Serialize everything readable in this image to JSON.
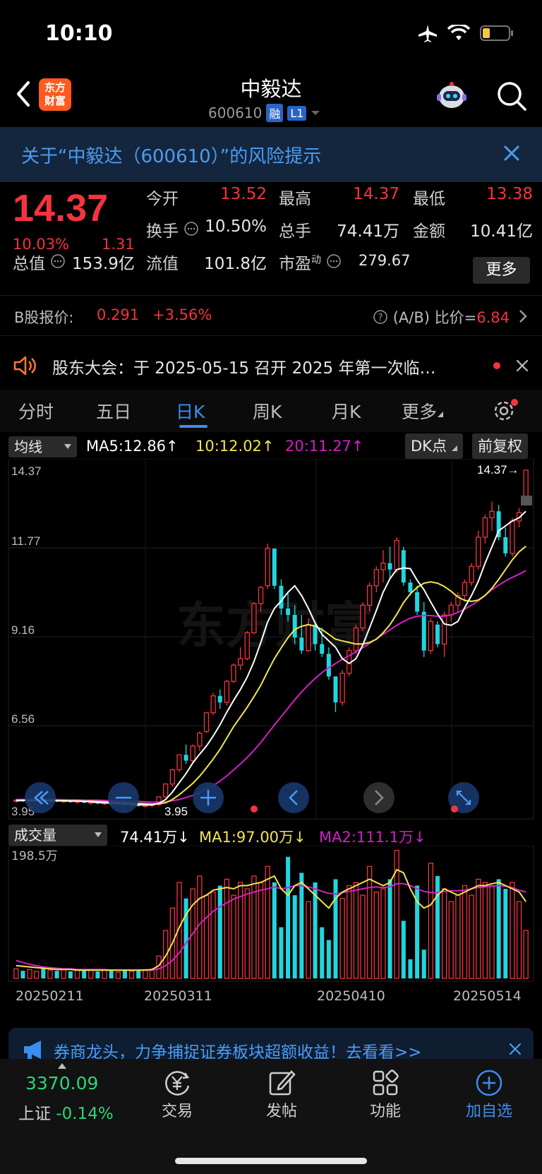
{
  "status": {
    "time": "10:10"
  },
  "header": {
    "logo_text_1": "东方",
    "logo_text_2": "财富",
    "name": "中毅达",
    "code": "600610",
    "tag1": "融",
    "tag2": "L1"
  },
  "risk": {
    "text": "关于“中毅达（600610）”的风险提示"
  },
  "quote": {
    "price": "14.37",
    "pct": "10.03%",
    "chg": "1.31",
    "open_label": "今开",
    "open": "13.52",
    "high_label": "最高",
    "high": "14.37",
    "low_label": "最低",
    "low": "13.38",
    "turnover_label": "换手",
    "turnover": "10.50%",
    "volume_label": "总手",
    "volume": "74.41万",
    "amount_label": "金额",
    "amount": "10.41亿",
    "mktcap_label": "总值",
    "mktcap": "153.9亿",
    "float_label": "流值",
    "float": "101.8亿",
    "pe_label": "市盈",
    "pe_sup": "动",
    "pe": "279.67",
    "more": "更多"
  },
  "bshare": {
    "label": "B股报价:",
    "price": "0.291",
    "pct": "+3.56%",
    "ratio_label": "(A/B) 比价=",
    "ratio": "6.84"
  },
  "notice": {
    "text": "股东大会：于 2025-05-15 召开 2025 年第一次临…"
  },
  "tabs": [
    "分时",
    "五日",
    "日K",
    "周K",
    "月K",
    "更多"
  ],
  "ma": {
    "label": "均线",
    "ma5": "MA5:12.86↑",
    "ma10": "10:12.02↑",
    "ma20": "20:11.27↑",
    "dk": "DK点",
    "adjust": "前复权"
  },
  "colors": {
    "up": "#f5333f",
    "down": "#1fd6df",
    "ma5": "#ffffff",
    "ma10": "#f2e64a",
    "ma20": "#d61ec6"
  },
  "kaxis": {
    "labels": [
      "14.37",
      "11.77",
      "9.16",
      "6.56",
      "3.95"
    ],
    "last_marker": "14.37→",
    "low_marker": "3.95"
  },
  "volume": {
    "label": "成交量",
    "current": "74.41万↓",
    "ma1": "MA1:97.00万↓",
    "ma2": "MA2:111.1万↓",
    "max_label": "198.5万"
  },
  "dates": [
    "20250211",
    "20250311",
    "20250410",
    "20250514"
  ],
  "ad": {
    "text": "券商龙头，力争捕捉证券板块超额收益！去看看>>"
  },
  "bottom": {
    "index_val": "3370.09",
    "index_name": "上证",
    "index_pct": "-0.14%",
    "nav": [
      "交易",
      "发帖",
      "功能",
      "加自选"
    ]
  },
  "chart_data": {
    "type": "candlestick",
    "ylim": [
      3.95,
      14.37
    ],
    "candles": [
      [
        4.15,
        4.2,
        4.1,
        4.18
      ],
      [
        4.18,
        4.22,
        4.12,
        4.15
      ],
      [
        4.15,
        4.2,
        4.08,
        4.18
      ],
      [
        4.18,
        4.24,
        4.14,
        4.2
      ],
      [
        4.2,
        4.24,
        4.12,
        4.15
      ],
      [
        4.15,
        4.2,
        4.1,
        4.18
      ],
      [
        4.18,
        4.22,
        4.12,
        4.14
      ],
      [
        4.14,
        4.2,
        4.1,
        4.16
      ],
      [
        4.16,
        4.2,
        4.1,
        4.12
      ],
      [
        4.12,
        4.18,
        4.06,
        4.15
      ],
      [
        4.15,
        4.2,
        4.08,
        4.1
      ],
      [
        4.1,
        4.16,
        4.04,
        4.12
      ],
      [
        4.12,
        4.16,
        4.05,
        4.08
      ],
      [
        4.08,
        4.14,
        4.02,
        4.1
      ],
      [
        4.1,
        4.14,
        4.0,
        4.05
      ],
      [
        4.05,
        4.1,
        3.98,
        4.08
      ],
      [
        4.08,
        4.12,
        4.0,
        4.02
      ],
      [
        4.02,
        4.08,
        3.95,
        4.05
      ],
      [
        4.05,
        4.1,
        3.98,
        4.0
      ],
      [
        4.0,
        4.05,
        3.95,
        4.02
      ],
      [
        4.02,
        4.08,
        3.96,
        4.04
      ],
      [
        4.04,
        4.3,
        4.0,
        4.28
      ],
      [
        4.28,
        4.7,
        4.25,
        4.68
      ],
      [
        4.68,
        5.15,
        4.6,
        5.12
      ],
      [
        5.12,
        5.6,
        5.05,
        5.58
      ],
      [
        5.58,
        5.9,
        5.3,
        5.4
      ],
      [
        5.4,
        5.9,
        5.35,
        5.85
      ],
      [
        5.85,
        6.3,
        5.7,
        6.25
      ],
      [
        6.3,
        6.9,
        6.25,
        6.88
      ],
      [
        6.88,
        7.5,
        6.8,
        7.4
      ],
      [
        7.4,
        7.6,
        7.0,
        7.2
      ],
      [
        7.2,
        7.9,
        7.1,
        7.85
      ],
      [
        7.85,
        8.4,
        7.8,
        8.35
      ],
      [
        8.35,
        8.9,
        8.2,
        8.55
      ],
      [
        8.55,
        9.4,
        8.5,
        9.35
      ],
      [
        9.35,
        10.3,
        9.3,
        10.25
      ],
      [
        10.25,
        10.8,
        10.0,
        10.75
      ],
      [
        10.8,
        12.1,
        10.7,
        11.95
      ],
      [
        11.95,
        11.95,
        10.7,
        10.8
      ],
      [
        10.8,
        11.0,
        9.9,
        10.1
      ],
      [
        10.1,
        10.6,
        9.7,
        9.9
      ],
      [
        9.9,
        10.2,
        9.0,
        9.2
      ],
      [
        9.2,
        9.9,
        8.7,
        8.8
      ],
      [
        8.8,
        9.8,
        8.75,
        9.6
      ],
      [
        9.6,
        9.7,
        8.8,
        9.0
      ],
      [
        9.0,
        9.5,
        8.6,
        8.7
      ],
      [
        8.7,
        8.9,
        7.9,
        8.0
      ],
      [
        8.0,
        8.0,
        6.9,
        7.2
      ],
      [
        7.2,
        8.2,
        7.1,
        8.1
      ],
      [
        8.1,
        8.9,
        8.0,
        8.8
      ],
      [
        8.8,
        9.6,
        8.7,
        9.5
      ],
      [
        9.5,
        10.3,
        9.4,
        10.2
      ],
      [
        10.2,
        10.9,
        10.0,
        10.8
      ],
      [
        10.8,
        11.4,
        10.6,
        11.3
      ],
      [
        11.3,
        11.9,
        10.9,
        11.5
      ],
      [
        11.5,
        12.0,
        11.0,
        11.3
      ],
      [
        11.3,
        12.3,
        11.2,
        12.2
      ],
      [
        11.9,
        12.0,
        10.8,
        10.9
      ],
      [
        10.9,
        11.0,
        10.5,
        10.6
      ],
      [
        10.6,
        10.8,
        9.9,
        10.0
      ],
      [
        10.0,
        10.3,
        8.6,
        8.8
      ],
      [
        8.8,
        9.8,
        8.7,
        9.7
      ],
      [
        9.6,
        9.7,
        8.9,
        9.0
      ],
      [
        9.0,
        10.0,
        8.6,
        9.9
      ],
      [
        9.9,
        10.3,
        9.7,
        10.2
      ],
      [
        10.2,
        10.6,
        10.0,
        10.5
      ],
      [
        10.5,
        11.0,
        10.3,
        10.9
      ],
      [
        10.9,
        11.5,
        10.8,
        11.4
      ],
      [
        11.4,
        12.5,
        11.3,
        12.3
      ],
      [
        12.3,
        13.0,
        12.1,
        12.9
      ],
      [
        12.9,
        13.4,
        12.5,
        13.1
      ],
      [
        13.1,
        13.3,
        12.2,
        12.3
      ],
      [
        12.3,
        12.6,
        11.7,
        11.8
      ],
      [
        11.8,
        12.9,
        11.7,
        12.8
      ],
      [
        12.8,
        13.2,
        12.6,
        13.06
      ],
      [
        13.52,
        14.37,
        13.38,
        14.37
      ]
    ],
    "ma5": [
      4.16,
      4.17,
      4.17,
      4.17,
      4.17,
      4.17,
      4.16,
      4.16,
      4.15,
      4.15,
      4.14,
      4.13,
      4.11,
      4.1,
      4.09,
      4.08,
      4.07,
      4.06,
      4.04,
      4.03,
      4.04,
      4.08,
      4.2,
      4.43,
      4.72,
      5.0,
      5.33,
      5.6,
      5.85,
      6.16,
      6.51,
      6.9,
      7.26,
      7.6,
      7.98,
      8.46,
      9.05,
      9.68,
      10.1,
      10.33,
      10.6,
      10.8,
      10.5,
      10.1,
      9.65,
      9.3,
      9.1,
      8.9,
      8.55,
      8.4,
      8.55,
      8.97,
      9.5,
      10.04,
      10.6,
      11.02,
      11.3,
      11.35,
      11.33,
      10.97,
      10.68,
      10.3,
      9.93,
      9.62,
      9.58,
      9.7,
      10.13,
      10.5,
      10.94,
      11.5,
      12.0,
      12.5,
      12.65,
      12.8,
      12.9,
      13.1
    ],
    "ma10": [
      4.18,
      4.18,
      4.18,
      4.18,
      4.18,
      4.17,
      4.17,
      4.17,
      4.16,
      4.16,
      4.15,
      4.15,
      4.14,
      4.13,
      4.12,
      4.11,
      4.1,
      4.09,
      4.08,
      4.07,
      4.06,
      4.07,
      4.1,
      4.2,
      4.35,
      4.52,
      4.7,
      4.92,
      5.18,
      5.45,
      5.75,
      6.1,
      6.45,
      6.75,
      7.05,
      7.38,
      7.73,
      8.15,
      8.55,
      8.88,
      9.2,
      9.45,
      9.55,
      9.6,
      9.55,
      9.45,
      9.3,
      9.15,
      9.1,
      9.05,
      9.0,
      9.0,
      9.05,
      9.15,
      9.35,
      9.6,
      9.92,
      10.28,
      10.55,
      10.75,
      10.88,
      10.92,
      10.88,
      10.78,
      10.63,
      10.45,
      10.35,
      10.32,
      10.36,
      10.5,
      10.72,
      11.0,
      11.3,
      11.6,
      11.85,
      12.02
    ],
    "ma20": [
      4.2,
      4.2,
      4.2,
      4.2,
      4.2,
      4.2,
      4.2,
      4.19,
      4.19,
      4.19,
      4.18,
      4.18,
      4.18,
      4.17,
      4.17,
      4.16,
      4.15,
      4.15,
      4.14,
      4.13,
      4.12,
      4.12,
      4.13,
      4.16,
      4.2,
      4.26,
      4.33,
      4.41,
      4.51,
      4.63,
      4.77,
      4.93,
      5.11,
      5.3,
      5.5,
      5.72,
      5.96,
      6.23,
      6.5,
      6.76,
      7.02,
      7.28,
      7.52,
      7.74,
      7.94,
      8.12,
      8.27,
      8.4,
      8.53,
      8.64,
      8.76,
      8.89,
      9.02,
      9.16,
      9.3,
      9.44,
      9.58,
      9.7,
      9.8,
      9.86,
      9.88,
      9.88,
      9.86,
      9.86,
      9.9,
      9.98,
      10.08,
      10.2,
      10.34,
      10.5,
      10.68,
      10.82,
      10.95,
      11.06,
      11.16,
      11.27
    ],
    "vol_max": 198.5,
    "volumes": [
      15,
      12,
      14,
      11,
      16,
      13,
      12,
      15,
      11,
      14,
      12,
      13,
      11,
      14,
      12,
      10,
      13,
      11,
      12,
      14,
      13,
      35,
      75,
      110,
      150,
      125,
      140,
      160,
      130,
      135,
      145,
      155,
      130,
      150,
      140,
      160,
      150,
      175,
      150,
      80,
      190,
      130,
      165,
      120,
      150,
      80,
      60,
      155,
      125,
      145,
      150,
      130,
      175,
      135,
      140,
      155,
      200,
      90,
      30,
      145,
      45,
      180,
      160,
      140,
      120,
      130,
      145,
      130,
      155,
      150,
      145,
      155,
      140,
      150,
      120,
      75
    ],
    "vol_ma1": [
      20,
      19,
      18,
      17,
      16,
      15,
      14,
      14,
      14,
      13,
      13,
      13,
      13,
      13,
      13,
      13,
      13,
      13,
      13,
      13,
      14,
      20,
      35,
      55,
      80,
      100,
      115,
      125,
      130,
      138,
      140,
      142,
      140,
      145,
      145,
      148,
      150,
      155,
      160,
      140,
      130,
      145,
      150,
      140,
      130,
      120,
      110,
      125,
      135,
      140,
      145,
      150,
      155,
      150,
      145,
      150,
      170,
      165,
      140,
      120,
      110,
      115,
      130,
      140,
      135,
      130,
      135,
      140,
      145,
      145,
      148,
      150,
      145,
      140,
      135,
      120
    ],
    "vol_ma2": [
      28,
      25,
      22,
      20,
      18,
      17,
      16,
      15,
      15,
      14,
      14,
      14,
      14,
      14,
      13,
      13,
      13,
      13,
      13,
      13,
      13,
      15,
      20,
      28,
      40,
      55,
      70,
      85,
      95,
      105,
      112,
      118,
      124,
      128,
      132,
      135,
      138,
      140,
      143,
      140,
      142,
      145,
      145,
      143,
      140,
      136,
      133,
      132,
      134,
      136,
      138,
      140,
      142,
      143,
      142,
      143,
      148,
      148,
      145,
      140,
      136,
      134,
      134,
      136,
      137,
      137,
      138,
      140,
      142,
      143,
      144,
      145,
      144,
      142,
      138,
      135
    ]
  }
}
